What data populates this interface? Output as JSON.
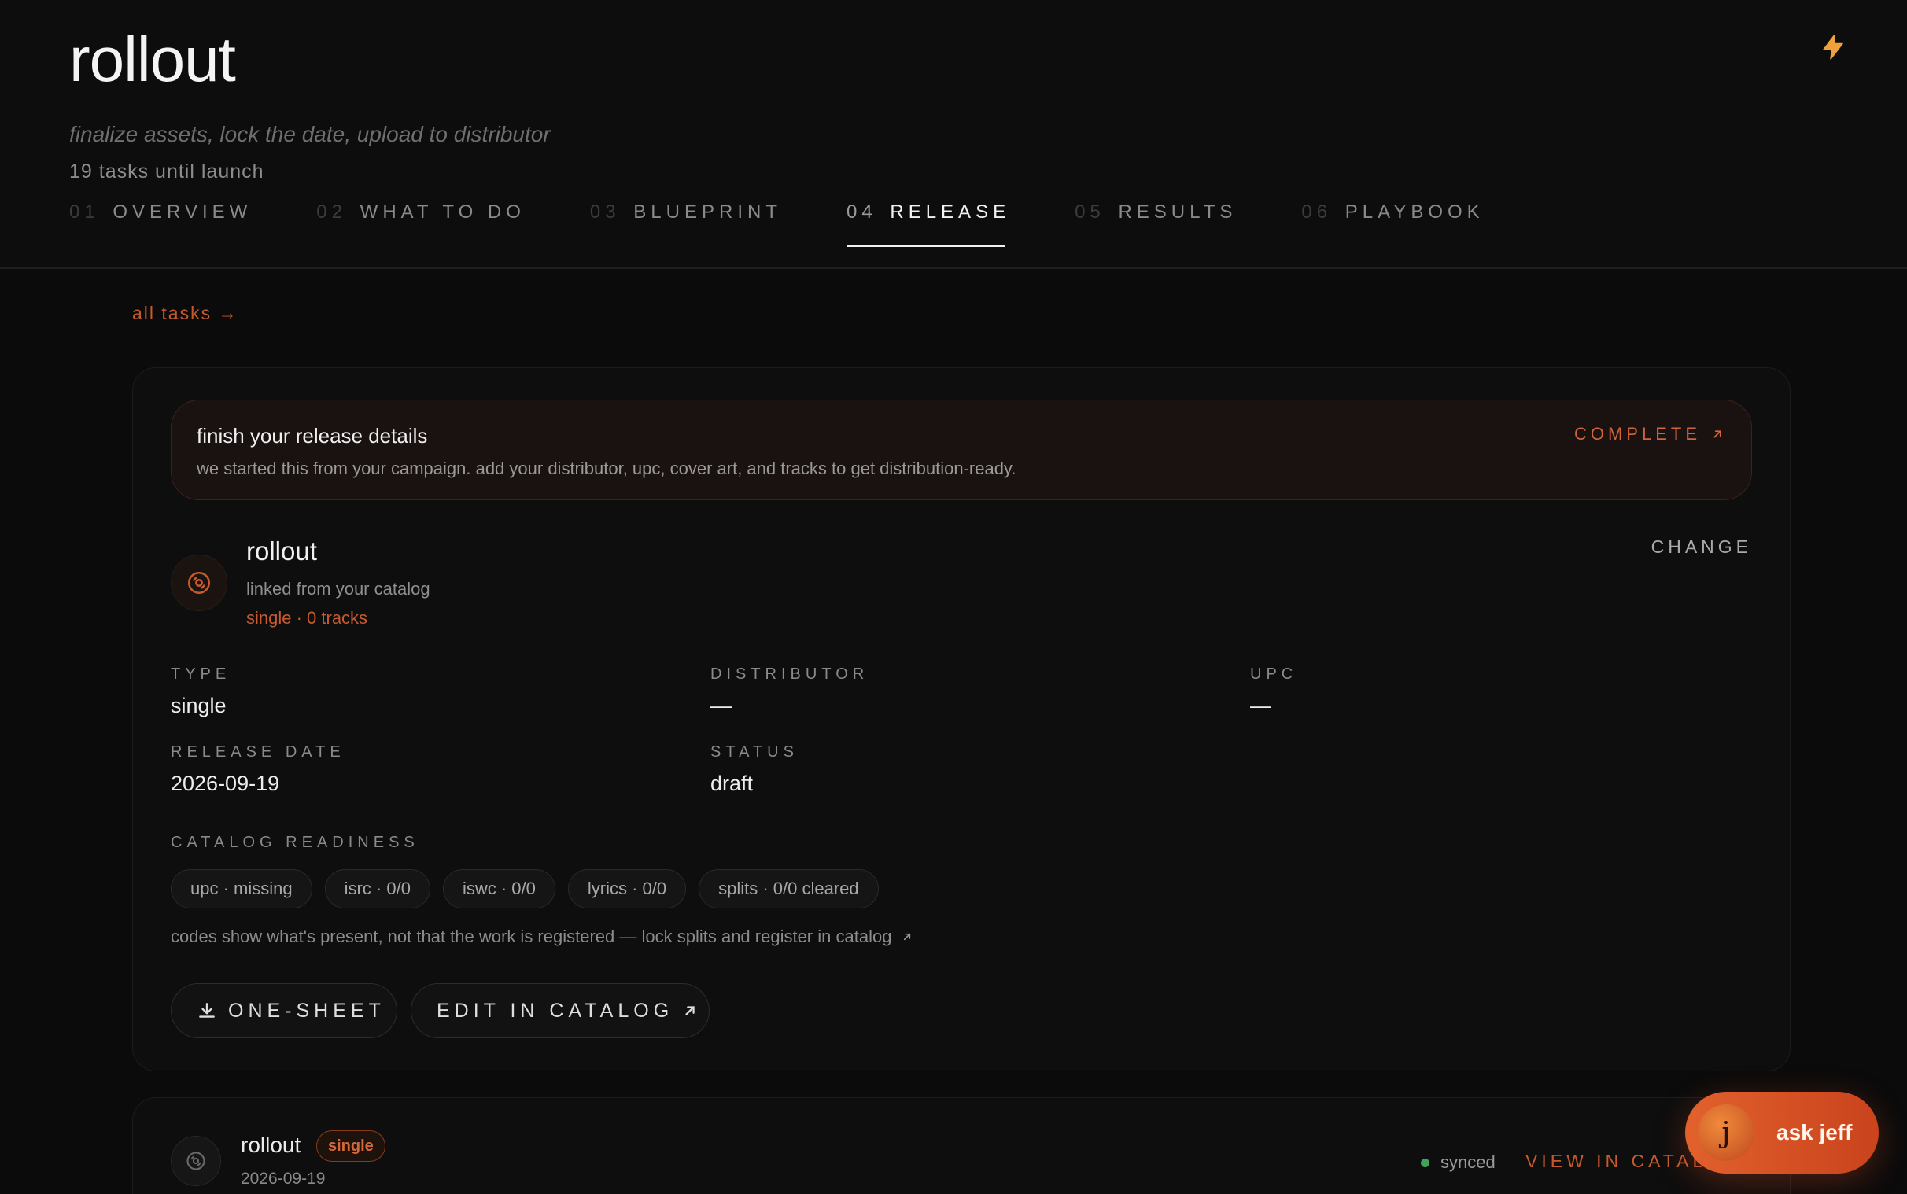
{
  "header": {
    "title": "rollout",
    "subtitle": "finalize assets, lock the date, upload to distributor",
    "counter": "19 tasks until launch",
    "tabs": [
      {
        "num": "01",
        "label": "OVERVIEW"
      },
      {
        "num": "02",
        "label": "WHAT TO DO"
      },
      {
        "num": "03",
        "label": "BLUEPRINT"
      },
      {
        "num": "04",
        "label": "RELEASE"
      },
      {
        "num": "05",
        "label": "RESULTS"
      },
      {
        "num": "06",
        "label": "PLAYBOOK"
      }
    ],
    "active_tab": "04",
    "icon": "bolt-icon"
  },
  "all_tasks_link": "all tasks →",
  "banner": {
    "title": "finish your release details",
    "description": "we started this from your campaign. add your distributor, upc, cover art, and tracks to get distribution-ready.",
    "cta": "COMPLETE"
  },
  "release": {
    "name": "rollout",
    "source": "linked from your catalog",
    "meta": "single · 0 tracks",
    "change_label": "CHANGE",
    "fields": {
      "type_label": "TYPE",
      "type_value": "single",
      "distributor_label": "DISTRIBUTOR",
      "distributor_value": "—",
      "upc_label": "UPC",
      "upc_value": "—",
      "release_date_label": "RELEASE DATE",
      "release_date_value": "2026-09-19",
      "status_label": "STATUS",
      "status_value": "draft"
    },
    "readiness_label": "CATALOG READINESS",
    "chips": [
      "upc · missing",
      "isrc · 0/0",
      "iswc · 0/0",
      "lyrics · 0/0",
      "splits · 0/0 cleared"
    ],
    "note": "codes show what's present, not that the work is registered — lock splits and register in catalog",
    "buttons": {
      "one_sheet": "ONE-SHEET",
      "edit_catalog": "EDIT IN CATALOG"
    }
  },
  "catalog_item": {
    "name": "rollout",
    "badge": "single",
    "date": "2026-09-19",
    "status": "synced",
    "view_link": "VIEW IN CATALOG"
  },
  "assistant": {
    "avatar_letter": "j",
    "label": "ask jeff"
  },
  "colors": {
    "accent": "#c65a2e",
    "background": "#0b0b0b",
    "synced": "#3fa457"
  }
}
